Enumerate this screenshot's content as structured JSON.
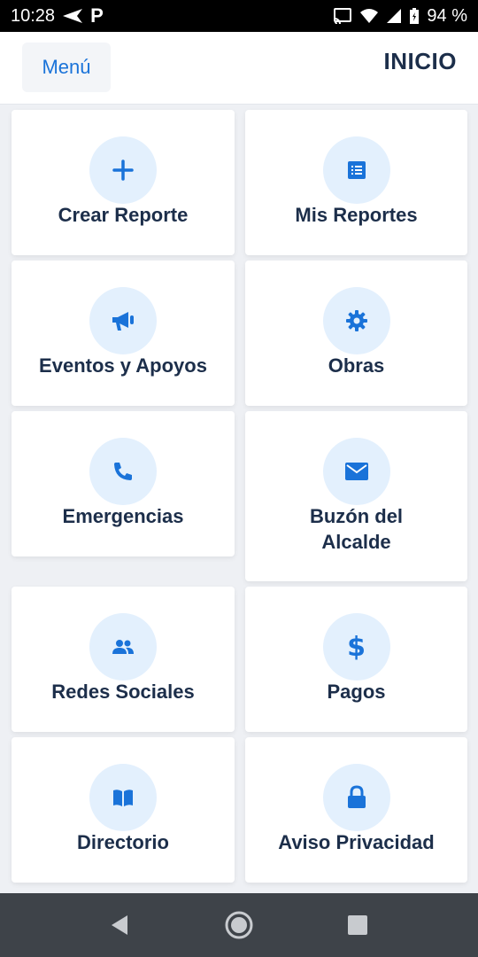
{
  "status_bar": {
    "time": "10:28",
    "battery": "94 %",
    "icons": [
      "send-icon",
      "parking-icon",
      "cast-icon",
      "wifi-icon",
      "signal-icon",
      "battery-icon"
    ]
  },
  "header": {
    "menu_label": "Menú",
    "title": "INICIO"
  },
  "tiles": [
    {
      "label": "Crear Reporte",
      "icon": "plus-icon"
    },
    {
      "label": "Mis Reportes",
      "icon": "list-icon"
    },
    {
      "label": "Eventos y Apoyos",
      "icon": "megaphone-icon"
    },
    {
      "label": "Obras",
      "icon": "gear-icon"
    },
    {
      "label": "Emergencias",
      "icon": "phone-icon"
    },
    {
      "label": "Buzón del Alcalde",
      "icon": "mail-icon"
    },
    {
      "label": "Redes Sociales",
      "icon": "people-icon"
    },
    {
      "label": "Pagos",
      "icon": "dollar-icon"
    },
    {
      "label": "Directorio",
      "icon": "book-icon"
    },
    {
      "label": "Aviso Privacidad",
      "icon": "lock-icon"
    }
  ],
  "nav_bar": {
    "buttons": [
      "back-icon",
      "home-icon",
      "recents-icon"
    ]
  },
  "colors": {
    "accent": "#1a73d9",
    "icon_bg": "#e3f0fd",
    "title_text": "#1c2e4a",
    "background": "#eef0f4",
    "nav_bar": "#3e4349"
  }
}
